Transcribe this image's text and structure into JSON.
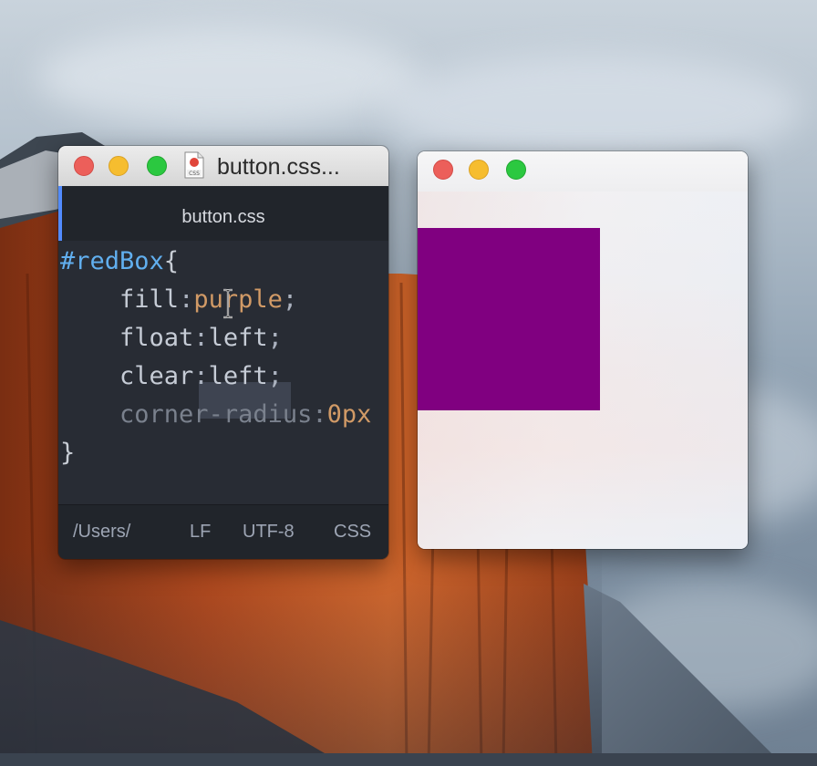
{
  "editor": {
    "window_title": "button.css...",
    "file_icon_label": "CSS",
    "tab_label": "button.css",
    "code": {
      "line1": {
        "selector": "#redBox",
        "brace": "{"
      },
      "line2": {
        "prop": "fill",
        "colon": ":",
        "value_selected": "purple",
        "semicolon": ";"
      },
      "line3": {
        "prop": "float",
        "colon": ":",
        "value": "left",
        "semicolon": ";"
      },
      "line4": {
        "prop": "clear",
        "colon": ":",
        "value": "left",
        "semicolon": ";"
      },
      "line5": {
        "prop": "corner-radius",
        "colon": ":",
        "value": "0px"
      },
      "line6": {
        "brace": "}"
      }
    },
    "status": {
      "path": "/Users/",
      "line_ending": "LF",
      "encoding": "UTF-8",
      "grammar": "CSS"
    }
  },
  "preview": {
    "box_color": "#800080"
  },
  "colors": {
    "traffic_close": "#ec5f5a",
    "traffic_minimize": "#f6bd2f",
    "traffic_zoom": "#2bc840",
    "editor_bg": "#282c34",
    "accent": "#528bff"
  },
  "icons": [
    "css-file-icon",
    "text-cursor-icon"
  ]
}
